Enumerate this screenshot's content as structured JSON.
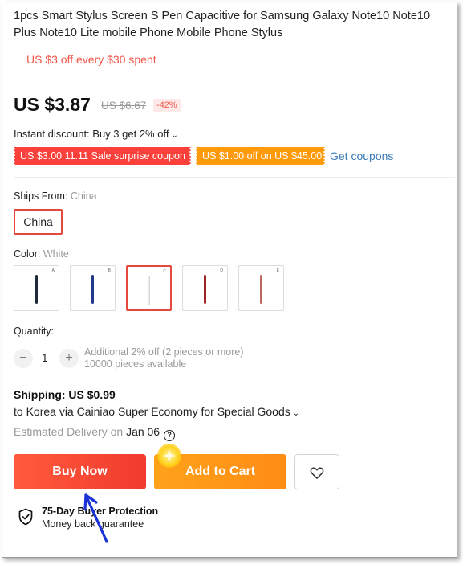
{
  "product": {
    "title": "1pcs Smart Stylus Screen S Pen Capacitive for Samsung Galaxy Note10 Note10 Plus Note10 Lite mobile Phone Mobile Phone Stylus",
    "promo_line": "US $3 off every $30 spent"
  },
  "price": {
    "current": "US $3.87",
    "original": "US $6.67",
    "discount": "-42%"
  },
  "instant_discount": {
    "text": "Instant discount: Buy 3 get 2% off",
    "chevron_icon": "chevron-down-icon"
  },
  "coupons": [
    {
      "label": "US $3.00 11.11 Sale surprise coupon",
      "color": "#f9403a"
    },
    {
      "label": "US $1.00 off on US $45.00",
      "color": "#ff9a0b"
    }
  ],
  "get_coupons_link": "Get coupons",
  "ships_from": {
    "label": "Ships From:",
    "value": "China",
    "options": [
      "China"
    ]
  },
  "color": {
    "label": "Color:",
    "value": "White",
    "swatches": [
      {
        "tag": "A",
        "pen_color": "#1e2a3a"
      },
      {
        "tag": "B",
        "pen_color": "#233a8c"
      },
      {
        "tag": "C",
        "pen_color": "#e8e8e8",
        "selected": true
      },
      {
        "tag": "D",
        "pen_color": "#a02424"
      },
      {
        "tag": "E",
        "pen_color": "#b96a5c"
      }
    ]
  },
  "quantity": {
    "label": "Quantity:",
    "value": "1",
    "minus": "−",
    "plus": "+",
    "note_line1": "Additional 2% off (2 pieces or more)",
    "note_line2": "10000 pieces available"
  },
  "shipping": {
    "title": "Shipping: US $0.99",
    "route": "to Korea via Cainiao Super Economy for Special Goods",
    "delivery_prefix": "Estimated Delivery on",
    "delivery_date": "Jan 06",
    "help_glyph": "?"
  },
  "actions": {
    "buy_now": "Buy Now",
    "add_to_cart": "Add to Cart",
    "wishlist_icon": "heart-icon"
  },
  "protection": {
    "title": "75-Day Buyer Protection",
    "subtitle": "Money back guarantee"
  }
}
